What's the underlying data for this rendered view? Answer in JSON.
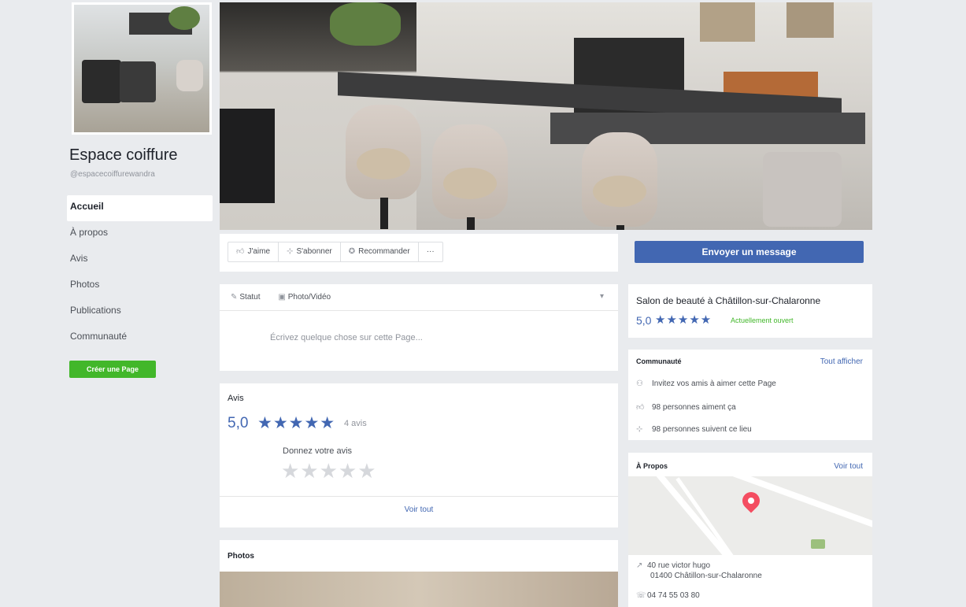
{
  "page": {
    "name": "Espace coiffure",
    "handle": "@espacecoiffurewandra"
  },
  "leftnav": {
    "items": [
      {
        "label": "Accueil"
      },
      {
        "label": "À propos"
      },
      {
        "label": "Avis"
      },
      {
        "label": "Photos"
      },
      {
        "label": "Publications"
      },
      {
        "label": "Communauté"
      }
    ],
    "create_page": "Créer une Page"
  },
  "actionbar": {
    "like": "J'aime",
    "follow": "S'abonner",
    "recommend": "Recommander",
    "more": "···",
    "send_message": "Envoyer un message"
  },
  "composer": {
    "status": "Statut",
    "photo_video": "Photo/Vidéo",
    "placeholder": "Écrivez quelque chose sur cette Page..."
  },
  "reviews": {
    "title": "Avis",
    "score": "5,0",
    "stars": "★★★★★",
    "count": "4 avis",
    "give_label": "Donnez votre avis",
    "empty_stars": "★★★★★",
    "see_all": "Voir tout"
  },
  "photos": {
    "title": "Photos"
  },
  "category": {
    "text": "Salon de beauté à Châtillon-sur-Chalaronne",
    "score": "5,0",
    "stars": "★★★★★",
    "open_status": "Actuellement ouvert"
  },
  "community": {
    "title": "Communauté",
    "see_all": "Tout afficher",
    "invite": "Invitez vos amis à aimer cette Page",
    "likes": "98 personnes aiment ça",
    "follows": "98 personnes suivent ce lieu"
  },
  "about": {
    "title": "À Propos",
    "see_all": "Voir tout",
    "address_line1": "40 rue victor hugo",
    "address_line2": "01400 Châtillon-sur-Chalaronne",
    "phone": "04 74 55 03 80"
  },
  "colors": {
    "brand_blue": "#4267b2",
    "green": "#42b72a",
    "map_pin": "#f44d61",
    "background": "#e9ebee"
  }
}
